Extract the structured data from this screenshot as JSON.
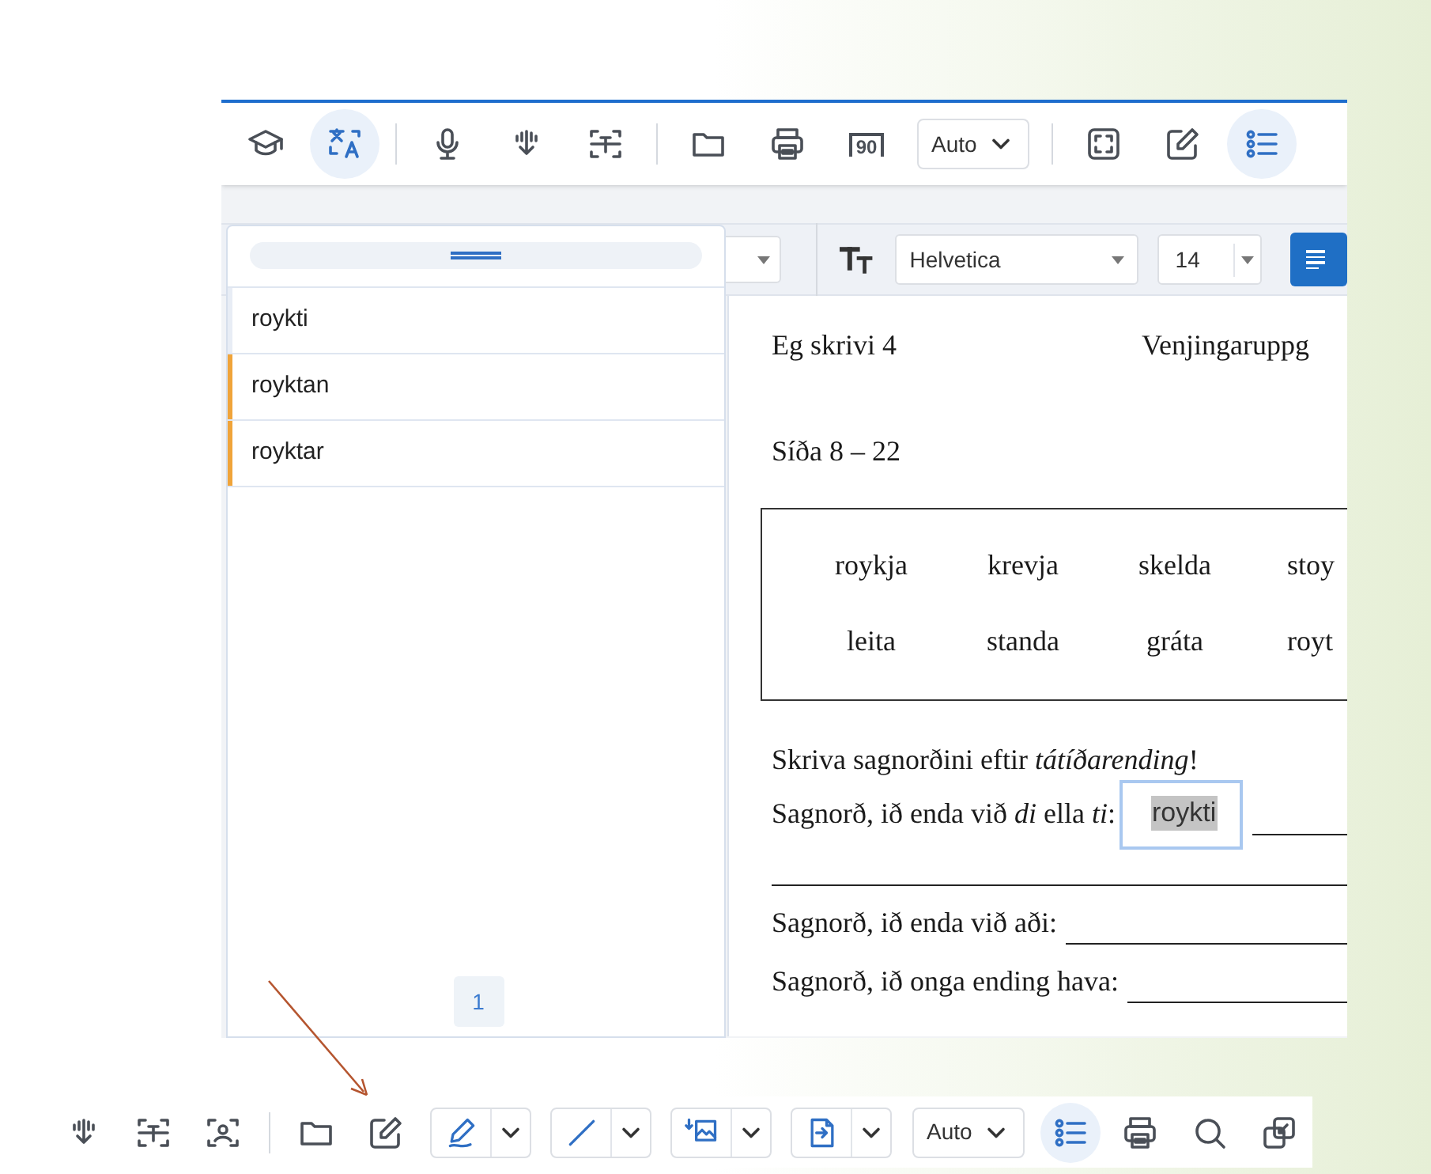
{
  "top_toolbar": {
    "items": [
      {
        "kind": "button",
        "selected": false
      },
      {
        "kind": "button",
        "selected": true
      },
      {
        "kind": "divider"
      },
      {
        "kind": "button",
        "selected": false
      },
      {
        "kind": "button",
        "selected": false
      },
      {
        "kind": "button",
        "selected": false
      },
      {
        "kind": "divider"
      },
      {
        "kind": "button",
        "selected": false
      },
      {
        "kind": "button",
        "selected": false
      },
      {
        "kind": "rotate",
        "label": "90",
        "selected": false
      },
      {
        "kind": "dropdown",
        "label": "Auto"
      },
      {
        "kind": "divider"
      },
      {
        "kind": "button",
        "selected": false
      },
      {
        "kind": "button",
        "selected": false
      },
      {
        "kind": "button",
        "selected": true
      }
    ]
  },
  "format_bar": {
    "font": "Helvetica",
    "size": "14",
    "align_left": {
      "selected": true
    }
  },
  "word_panel": {
    "suggestions": [
      {
        "text": "roykti",
        "highlighted": false
      },
      {
        "text": "royktan",
        "highlighted": true
      },
      {
        "text": "royktar",
        "highlighted": true
      }
    ],
    "page": "1"
  },
  "document": {
    "header_left": "Eg skrivi 4",
    "header_right": "Venjingaruppg",
    "page_range": "Síða 8 – 22",
    "word_box": [
      [
        "roykja",
        "krevja",
        "skelda",
        "stoy"
      ],
      [
        "leita",
        "standa",
        "gráta",
        "royt"
      ]
    ],
    "instruction": "Skriva sagnorðini  eftir *tátíðarending*!",
    "answer_lines": [
      {
        "kind": "answer",
        "prompt": "Sagnorð, ið enda við *di* ella *ti*:",
        "value": "roykti"
      },
      {
        "kind": "line"
      },
      {
        "kind": "prompt",
        "prompt": "Sagnorð, ið enda við aði:"
      },
      {
        "kind": "prompt",
        "prompt": "Sagnorð, ið onga ending hava:"
      }
    ]
  },
  "bottom_toolbar": {
    "items": [
      {
        "kind": "button",
        "selected": false
      },
      {
        "kind": "button",
        "selected": false
      },
      {
        "kind": "button",
        "selected": false
      },
      {
        "kind": "divider"
      },
      {
        "kind": "button",
        "selected": false
      },
      {
        "kind": "button",
        "selected": false
      },
      {
        "kind": "split"
      },
      {
        "kind": "split"
      },
      {
        "kind": "split"
      },
      {
        "kind": "split"
      },
      {
        "kind": "dropdown",
        "label": "Auto"
      },
      {
        "kind": "button",
        "selected": true
      },
      {
        "kind": "button",
        "selected": false
      },
      {
        "kind": "button",
        "selected": false
      },
      {
        "kind": "button",
        "selected": false
      }
    ]
  }
}
